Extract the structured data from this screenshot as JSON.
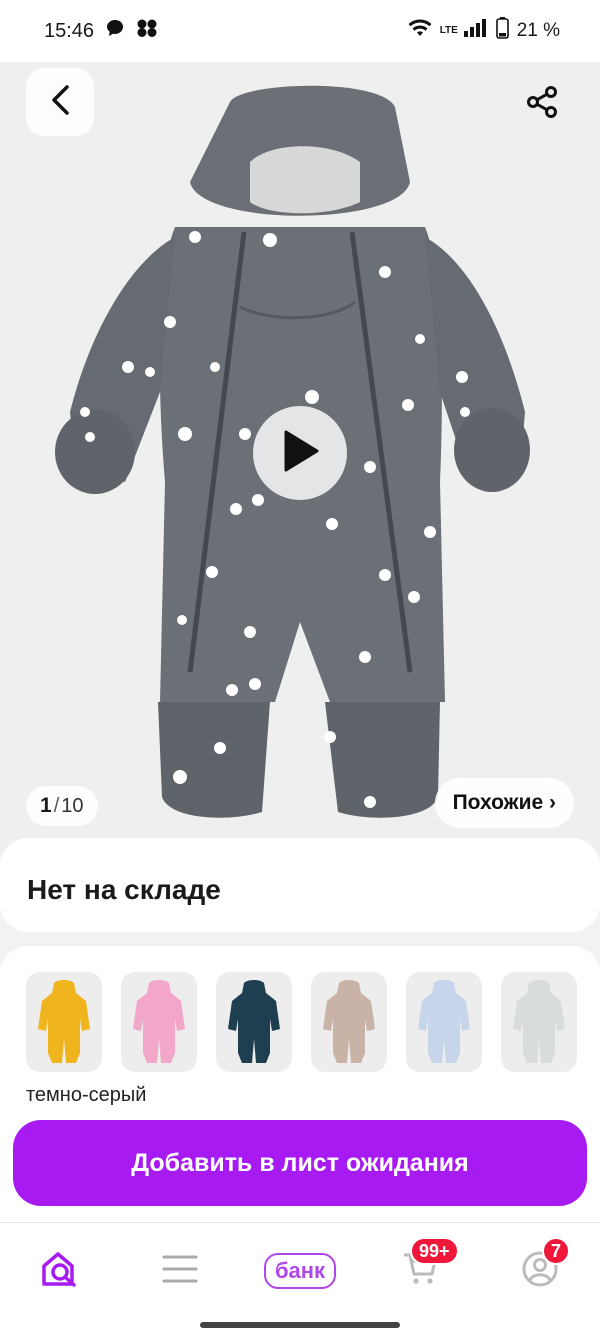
{
  "status_bar": {
    "time": "15:46",
    "battery": "21 %",
    "network": "LTE"
  },
  "hero": {
    "counter_current": "1",
    "counter_separator": "/",
    "counter_total": "10",
    "similar_label": "Похожие ›"
  },
  "stock": {
    "title": "Нет на складе"
  },
  "colors": {
    "selected_name": "темно-серый",
    "swatches": [
      {
        "name": "yellow",
        "color": "#f0b41e"
      },
      {
        "name": "pink",
        "color": "#f2a7c9"
      },
      {
        "name": "dark-teal",
        "color": "#1e3f4f"
      },
      {
        "name": "beige",
        "color": "#c8b3a6"
      },
      {
        "name": "light-blue",
        "color": "#c9d9ee"
      },
      {
        "name": "light-gray",
        "color": "#d8dedf"
      }
    ]
  },
  "actions": {
    "add_to_waitlist": "Добавить в лист ожидания"
  },
  "bottom_nav": {
    "bank_label": "банк",
    "cart_badge": "99+",
    "profile_badge": "7"
  },
  "theme": {
    "accent": "#a71bf2",
    "badge": "#f0183a",
    "product": "#6b6f76"
  }
}
